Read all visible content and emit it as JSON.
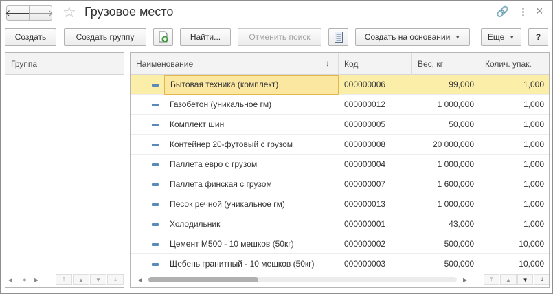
{
  "window": {
    "title": "Грузовое место",
    "back_icon": "🡐",
    "forward_icon": "🡒",
    "star_icon": "☆",
    "link_icon": "🔗",
    "menu_icon": "⋮",
    "close_icon": "×"
  },
  "toolbar": {
    "create_label": "Создать",
    "create_group_label": "Создать группу",
    "find_label": "Найти...",
    "cancel_search_label": "Отменить поиск",
    "create_based_label": "Создать на основании",
    "more_label": "Еще",
    "help_label": "?",
    "dropdown_caret": "▼"
  },
  "group_panel": {
    "header": "Группа",
    "scroll_dot": "●",
    "left_arrow": "◀",
    "right_arrow": "▶",
    "nav": [
      "⤒",
      "▲",
      "▼",
      "⤓"
    ]
  },
  "table": {
    "columns": {
      "name": "Наименование",
      "code": "Код",
      "weight": "Вес, кг",
      "qty": "Колич. упак."
    },
    "sort_indicator": "↓",
    "rows": [
      {
        "name": "Бытовая техника (комплект)",
        "code": "000000006",
        "weight": "99,000",
        "qty": "1,000"
      },
      {
        "name": "Газобетон (уникальное гм)",
        "code": "000000012",
        "weight": "1 000,000",
        "qty": "1,000"
      },
      {
        "name": "Комплект шин",
        "code": "000000005",
        "weight": "50,000",
        "qty": "1,000"
      },
      {
        "name": "Контейнер 20-футовый с грузом",
        "code": "000000008",
        "weight": "20 000,000",
        "qty": "1,000"
      },
      {
        "name": "Паллета евро с грузом",
        "code": "000000004",
        "weight": "1 000,000",
        "qty": "1,000"
      },
      {
        "name": "Паллета финская с грузом",
        "code": "000000007",
        "weight": "1 600,000",
        "qty": "1,000"
      },
      {
        "name": "Песок речной (уникальное гм)",
        "code": "000000013",
        "weight": "1 000,000",
        "qty": "1,000"
      },
      {
        "name": "Холодильник",
        "code": "000000001",
        "weight": "43,000",
        "qty": "1,000"
      },
      {
        "name": "Цемент М500 - 10 мешков (50кг)",
        "code": "000000002",
        "weight": "500,000",
        "qty": "10,000"
      },
      {
        "name": "Щебень гранитный - 10 мешков (50кг)",
        "code": "000000003",
        "weight": "500,000",
        "qty": "10,000"
      }
    ],
    "scroll": {
      "left_arrow": "◀",
      "right_arrow": "▶",
      "nav": [
        "⤒",
        "▲",
        "▼",
        "⤓"
      ]
    }
  },
  "colors": {
    "selected_row": "#fbeea8",
    "focus_border": "#e2b84d",
    "row_icon": "#5a8ab9",
    "add_icon_green": "#3f9a3f"
  }
}
